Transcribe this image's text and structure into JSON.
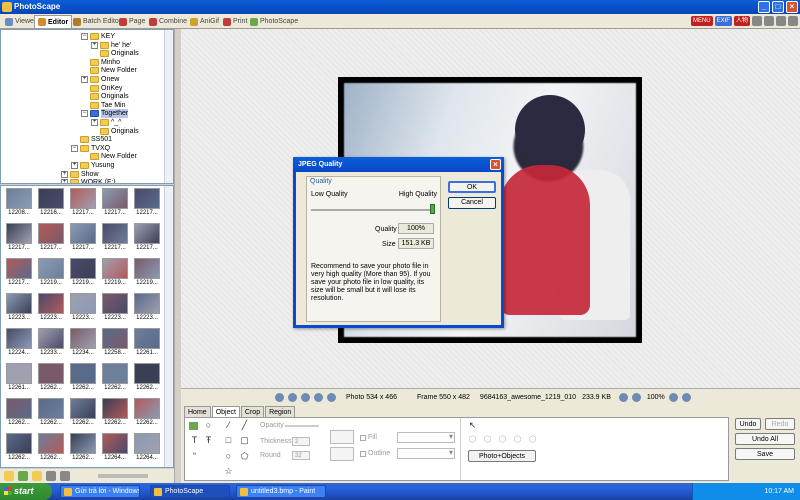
{
  "app": {
    "title": "PhotoScape"
  },
  "tabs": [
    {
      "label": "Viewer",
      "color": "#6a8cc8"
    },
    {
      "label": "Editor",
      "color": "#d78a2a"
    },
    {
      "label": "Batch Editor",
      "color": "#b07c2a"
    },
    {
      "label": "Page",
      "color": "#c23c3c"
    },
    {
      "label": "Combine",
      "color": "#c23c3c"
    },
    {
      "label": "AniGif",
      "color": "#d0a030"
    },
    {
      "label": "Print",
      "color": "#c23c3c"
    },
    {
      "label": "PhotoScape",
      "color": "#6aa84f"
    }
  ],
  "header_badges": [
    "MENU",
    "EXIF",
    "人物"
  ],
  "tree": [
    {
      "label": "KEY",
      "indent": 2,
      "exp": "−"
    },
    {
      "label": "he' he'",
      "indent": 3,
      "exp": "+"
    },
    {
      "label": "Originals",
      "indent": 3,
      "exp": ""
    },
    {
      "label": "Minho",
      "indent": 2,
      "exp": ""
    },
    {
      "label": "New Folder",
      "indent": 2,
      "exp": ""
    },
    {
      "label": "Onew",
      "indent": 2,
      "exp": "+"
    },
    {
      "label": "OnKey",
      "indent": 2,
      "exp": ""
    },
    {
      "label": "Originals",
      "indent": 2,
      "exp": ""
    },
    {
      "label": "Tae Min",
      "indent": 2,
      "exp": ""
    },
    {
      "label": "Together",
      "indent": 2,
      "exp": "−",
      "selected": true
    },
    {
      "label": "^_^",
      "indent": 3,
      "exp": "+"
    },
    {
      "label": "Originals",
      "indent": 3,
      "exp": ""
    },
    {
      "label": "SS501",
      "indent": 1,
      "exp": ""
    },
    {
      "label": "TVXQ",
      "indent": 1,
      "exp": "−"
    },
    {
      "label": "New Folder",
      "indent": 2,
      "exp": ""
    },
    {
      "label": "Yusung",
      "indent": 1,
      "exp": "+"
    },
    {
      "label": "Show",
      "indent": 0,
      "exp": "+"
    },
    {
      "label": "WORK (F:)",
      "indent": 0,
      "exp": "+"
    }
  ],
  "thumbs": [
    [
      "12208...",
      "12216...",
      "12217...",
      "12217...",
      "12217..."
    ],
    [
      "12217...",
      "12217...",
      "12217...",
      "12217...",
      "12217..."
    ],
    [
      "12217...",
      "12219...",
      "12219...",
      "12219...",
      "12219..."
    ],
    [
      "12223...",
      "12223...",
      "12223...",
      "12223...",
      "12223..."
    ],
    [
      "12224...",
      "12233...",
      "12234...",
      "12258...",
      "12261..."
    ],
    [
      "12261...",
      "12262...",
      "12262...",
      "12262...",
      "12262..."
    ],
    [
      "12262...",
      "12262...",
      "12262...",
      "12262...",
      "12262..."
    ],
    [
      "12262...",
      "12262...",
      "12262...",
      "12264...",
      "12264..."
    ]
  ],
  "status": {
    "photo": "Photo 534 x 466",
    "frame": "Frame 550 x 482",
    "filename": "9684163_awesome_1219_010",
    "filesize": "233.9 KB",
    "zoom": "100%"
  },
  "bottom_tabs": [
    "Home",
    "Object",
    "Crop",
    "Region"
  ],
  "bottom": {
    "opacity": "Opacity",
    "thickness": "Thickness",
    "round": "Round",
    "thickness_val": "2",
    "round_val": "32",
    "fill": "Fill",
    "outline": "Outline",
    "photo_objects": "Photo+Objects",
    "undo": "Undo",
    "redo": "Redo",
    "undo_all": "Undo All",
    "save": "Save"
  },
  "dialog": {
    "title": "JPEG Quality",
    "group": "Quality",
    "low": "Low Quality",
    "high": "High Quality",
    "quality_label": "Quality",
    "quality_value": "100%",
    "size_label": "Size",
    "size_value": "151.3 KB",
    "slider_fraction": 1.0,
    "message": "Recommend to save your photo file in very high quality (More than 95). If you save your photo file in low quality, its size will be small but it will lose its resolution.",
    "ok": "OK",
    "cancel": "Cancel"
  },
  "taskbar": {
    "start": "start",
    "items": [
      "Gửi trả lời - Windows ...",
      "PhotoScape",
      "untitled3.bmp - Paint"
    ],
    "clock": "10:17 AM"
  }
}
